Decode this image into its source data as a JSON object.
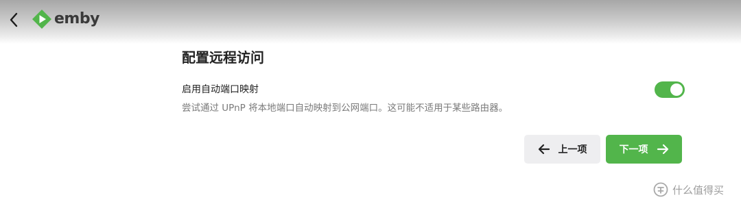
{
  "header": {
    "back_icon": "chevron-left-icon",
    "logo_icon": "emby-logo-icon",
    "logo_text": "emby",
    "brand_color": "#52b54b"
  },
  "page": {
    "title": "配置远程访问"
  },
  "setting": {
    "label": "启用自动端口映射",
    "description": "尝试通过 UPnP 将本地端口自动映射到公网端口。这可能不适用于某些路由器。",
    "enabled": true,
    "toggle_color": "#52b54b"
  },
  "nav": {
    "prev_label": "上一项",
    "prev_icon": "arrow-left-icon",
    "next_label": "下一项",
    "next_icon": "arrow-right-icon"
  },
  "watermark": {
    "text": "什么值得买"
  }
}
